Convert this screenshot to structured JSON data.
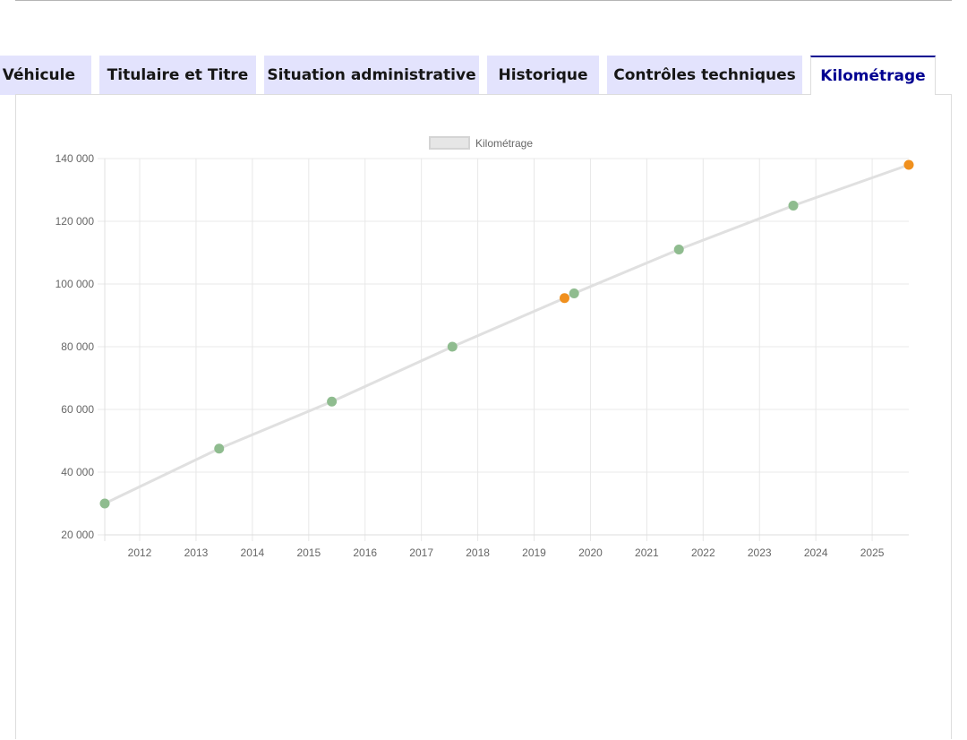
{
  "tabs": [
    {
      "label": "Véhicule",
      "active": false
    },
    {
      "label": "Titulaire et Titre",
      "active": false
    },
    {
      "label": "Situation administrative",
      "active": false
    },
    {
      "label": "Historique",
      "active": false
    },
    {
      "label": "Contrôles techniques",
      "active": false
    },
    {
      "label": "Kilométrage",
      "active": true
    }
  ],
  "colors": {
    "tab_background": "#e3e3fd",
    "active_tab_text": "#000091",
    "line": "#e0e0e0",
    "point_green": "#8fbc8f",
    "point_orange": "#f0901e"
  },
  "chart_data": {
    "type": "line",
    "legend": {
      "label": "Kilométrage",
      "position": "top"
    },
    "xlabel": "",
    "ylabel": "",
    "x_ticks": [
      "2012",
      "2013",
      "2014",
      "2015",
      "2016",
      "2017",
      "2018",
      "2019",
      "2020",
      "2021",
      "2022",
      "2023",
      "2024",
      "2025"
    ],
    "y_ticks": [
      "20 000",
      "40 000",
      "60 000",
      "80 000",
      "100 000",
      "120 000",
      "140 000"
    ],
    "xlim": [
      2011.38,
      2025.65
    ],
    "ylim": [
      20000,
      140000
    ],
    "grid": true,
    "series": [
      {
        "name": "Kilométrage",
        "points": [
          {
            "x": 2011.38,
            "y": 30000,
            "status": "green"
          },
          {
            "x": 2013.41,
            "y": 47500,
            "status": "green"
          },
          {
            "x": 2015.41,
            "y": 62500,
            "status": "green"
          },
          {
            "x": 2017.55,
            "y": 80000,
            "status": "green"
          },
          {
            "x": 2019.54,
            "y": 95500,
            "status": "orange"
          },
          {
            "x": 2019.71,
            "y": 97000,
            "status": "green"
          },
          {
            "x": 2021.57,
            "y": 111000,
            "status": "green"
          },
          {
            "x": 2023.6,
            "y": 125000,
            "status": "green"
          },
          {
            "x": 2025.65,
            "y": 138000,
            "status": "orange"
          }
        ]
      }
    ]
  }
}
